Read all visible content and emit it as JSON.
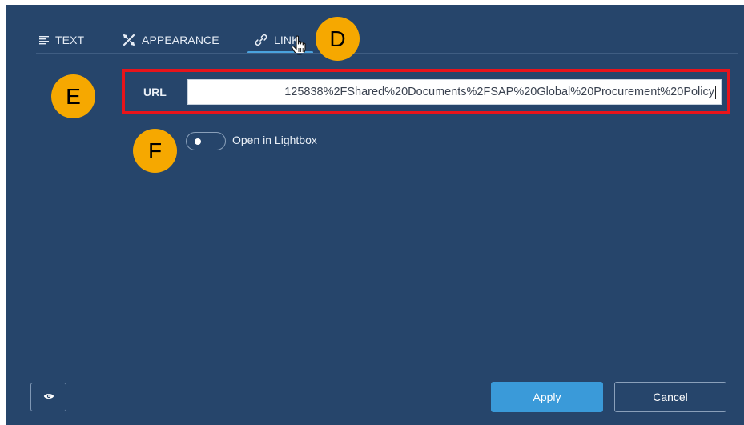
{
  "tabs": {
    "items": [
      {
        "label": "TEXT",
        "icon": "text-align-icon"
      },
      {
        "label": "APPEARANCE",
        "icon": "appearance-icon"
      },
      {
        "label": "LINK",
        "icon": "link-icon"
      }
    ],
    "active": "LINK"
  },
  "callouts": {
    "d": "D",
    "e": "E",
    "f": "F"
  },
  "url_field": {
    "label": "URL",
    "value": "125838%2FShared%20Documents%2FSAP%20Global%20Procurement%20Policy"
  },
  "lightbox_toggle": {
    "label": "Open in Lightbox",
    "on": false
  },
  "footer": {
    "preview_icon": "eye-icon",
    "apply_label": "Apply",
    "cancel_label": "Cancel"
  },
  "colors": {
    "panel_bg": "#26456b",
    "accent": "#3a9ad9",
    "callout": "#f6a800",
    "highlight": "#e8141b"
  }
}
